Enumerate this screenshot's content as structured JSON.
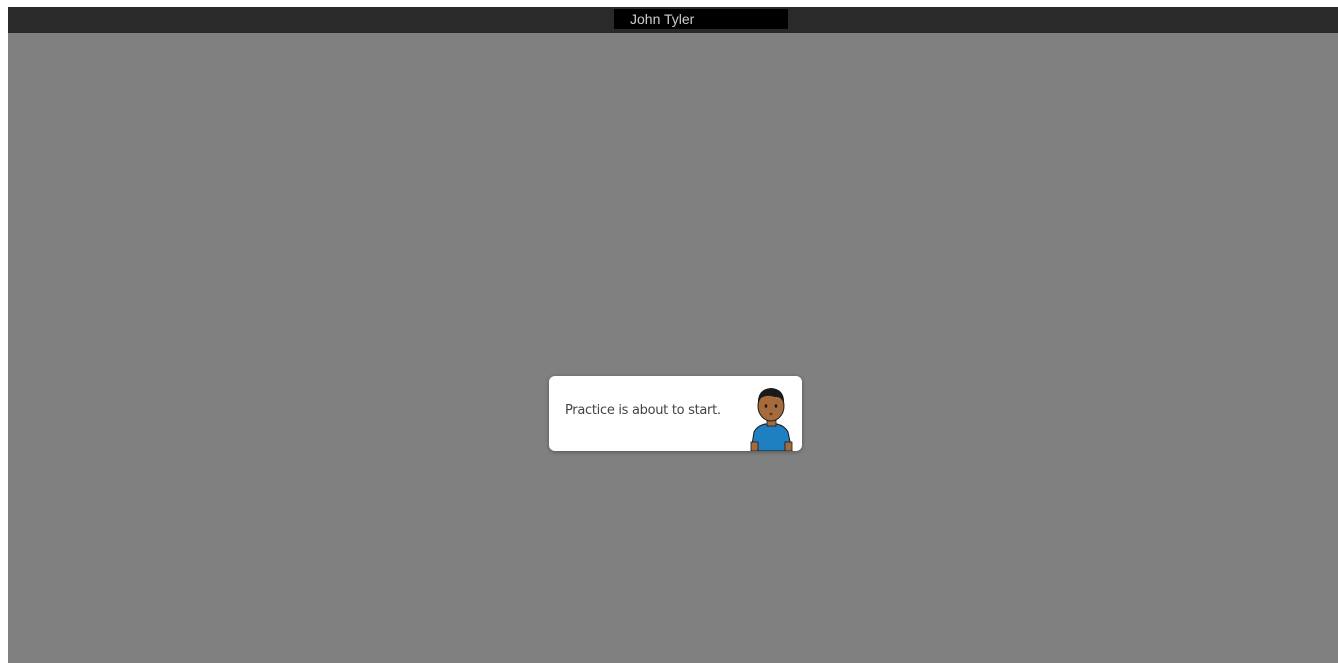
{
  "header": {
    "user_name": "John Tyler"
  },
  "dialog": {
    "message": "Practice is about to start.",
    "avatar_icon": "boy-avatar-icon"
  },
  "colors": {
    "frame_background": "#808080",
    "top_bar": "#2a2a2a",
    "name_box": "#000000",
    "dialog_background": "#ffffff",
    "shirt": "#1e7fc1",
    "skin": "#a66b3c",
    "hair": "#1a1a1a"
  }
}
